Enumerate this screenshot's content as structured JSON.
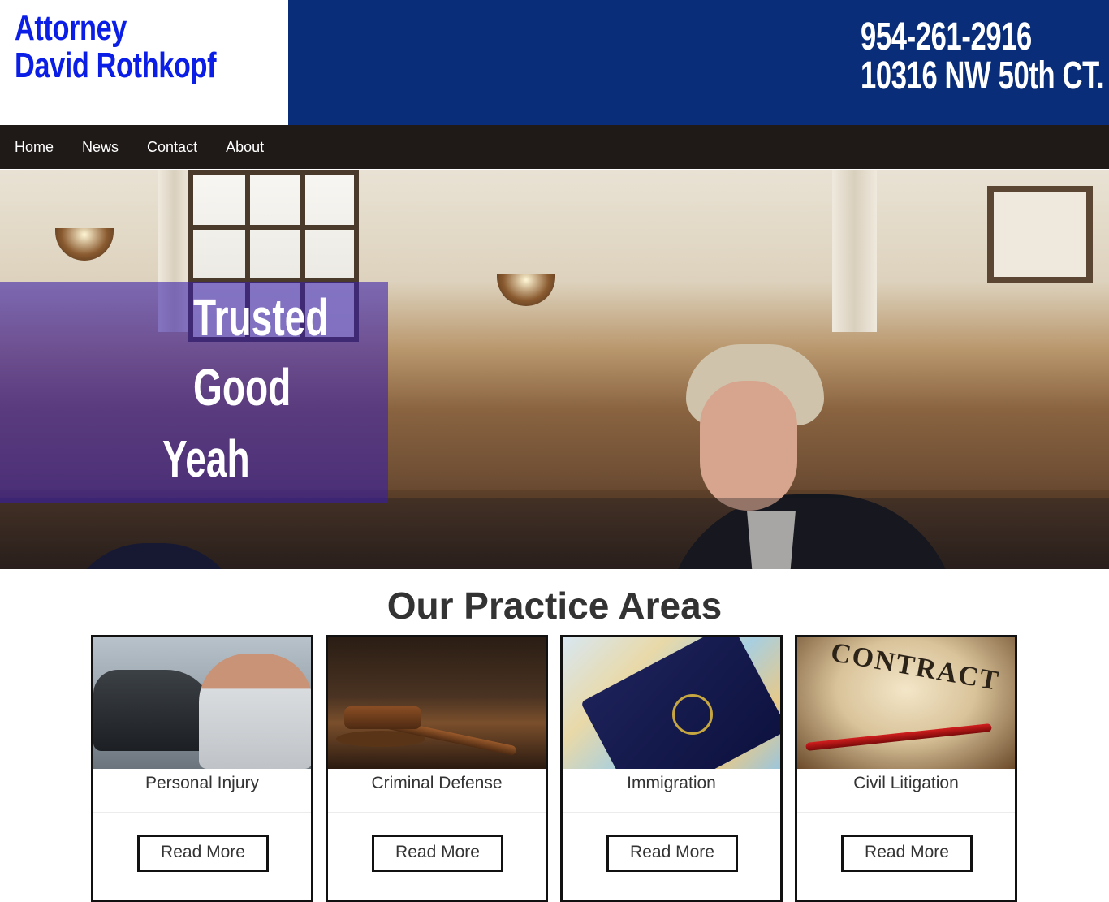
{
  "header": {
    "logo_line1": "Attorney",
    "logo_line2": "David Rothkopf",
    "phone": "954-261-2916",
    "address": "10316 NW 50th CT."
  },
  "nav": {
    "items": [
      {
        "label": "Home"
      },
      {
        "label": "News"
      },
      {
        "label": "Contact"
      },
      {
        "label": "About"
      }
    ]
  },
  "hero": {
    "words": [
      "Trusted",
      "Good",
      "Yeah"
    ]
  },
  "practice": {
    "title": "Our Practice Areas",
    "cards": [
      {
        "label": "Personal Injury",
        "button": "Read More"
      },
      {
        "label": "Criminal Defense",
        "button": "Read More"
      },
      {
        "label": "Immigration",
        "button": "Read More"
      },
      {
        "label": "Civil Litigation",
        "button": "Read More"
      }
    ],
    "image_text": {
      "civil": "CONTRACT"
    }
  },
  "colors": {
    "header_bg": "#0a2d79",
    "logo_text": "#0b1ee6",
    "nav_bg": "#1f1a17",
    "overlay": "#3720aa"
  }
}
